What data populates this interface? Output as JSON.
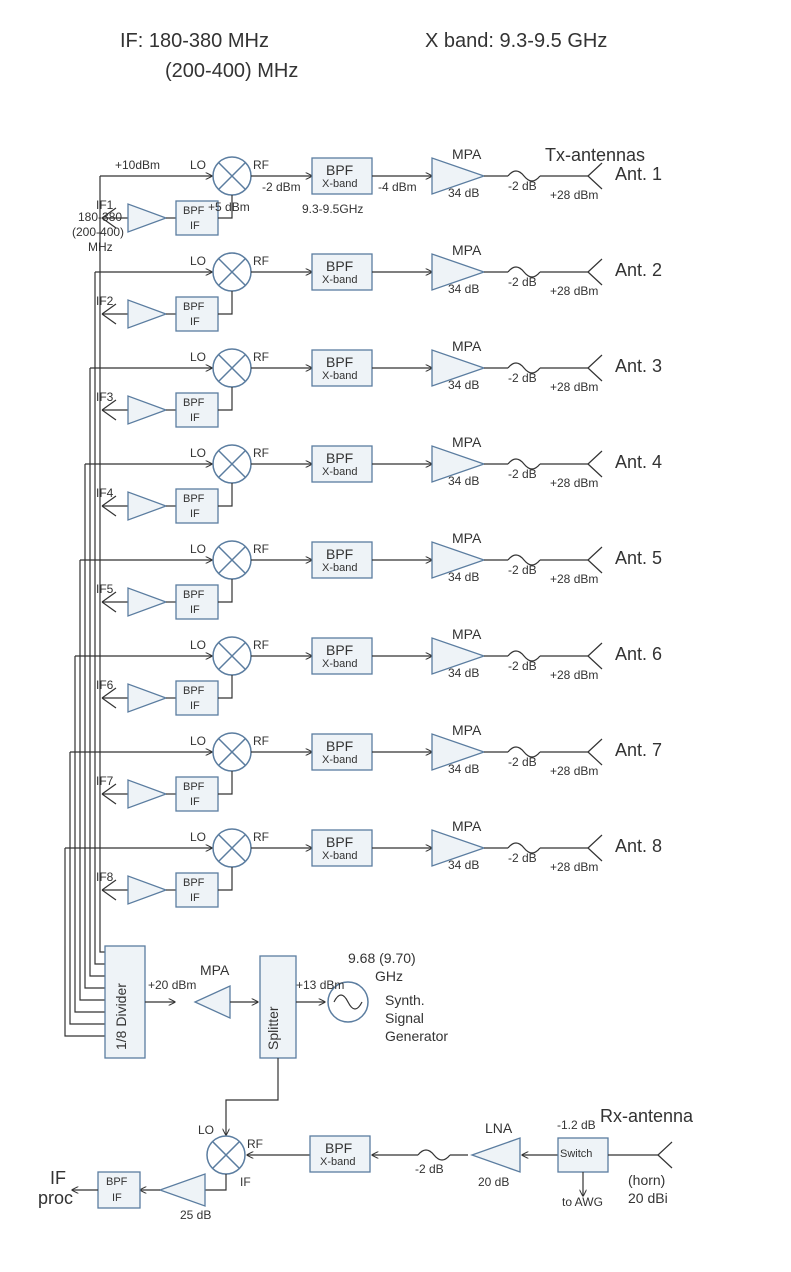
{
  "header": {
    "if_title": "IF:  180-380 MHz",
    "if_sub": "(200-400) MHz",
    "xband_title": "X band: 9.3-9.5 GHz"
  },
  "tx_header": "Tx-antennas",
  "common": {
    "lo_power": "+10dBm",
    "lo": "LO",
    "rf": "RF",
    "if": "IF",
    "bpf": "BPF",
    "mpa": "MPA",
    "xband": "X-band",
    "mixer_out": "-2 dBm",
    "bpf_out": "-4 dBm",
    "mpa_gain": "34 dB",
    "cable_loss": "-2 dB",
    "ant_pwr": "+28 dBm",
    "if_in_pwr": "+5 dBm",
    "bpf_freq": "9.3-9.5GHz"
  },
  "if_in_freq": {
    "l1": "180-380",
    "l2": "(200-400)",
    "l3": "MHz"
  },
  "channels": [
    {
      "if": "IF1",
      "ant": "Ant. 1"
    },
    {
      "if": "IF2",
      "ant": "Ant. 2"
    },
    {
      "if": "IF3",
      "ant": "Ant. 3"
    },
    {
      "if": "IF4",
      "ant": "Ant. 4"
    },
    {
      "if": "IF5",
      "ant": "Ant. 5"
    },
    {
      "if": "IF6",
      "ant": "Ant. 6"
    },
    {
      "if": "IF7",
      "ant": "Ant. 7"
    },
    {
      "if": "IF8",
      "ant": "Ant. 8"
    }
  ],
  "divider": {
    "label": "1/8 Divider",
    "out_pwr": "+20 dBm",
    "mpa": "MPA",
    "splitter": "Splitter",
    "sig_pwr": "+13 dBm",
    "sig_freq": "9.68 (9.70)",
    "sig_unit": "GHz",
    "sig_name1": "Synth.",
    "sig_name2": "Signal",
    "sig_name3": "Generator"
  },
  "rx": {
    "header": "Rx-antenna",
    "lna": "LNA",
    "lna_gain": "20 dB",
    "loss": "-2 dB",
    "switch": "Switch",
    "switch_loss": "-1.2 dB",
    "horn": "(horn)",
    "horn_gain": "20 dBi",
    "to_awg": "to AWG",
    "amp_gain": "25 dB",
    "ifproc1": "IF",
    "ifproc2": "proc"
  }
}
